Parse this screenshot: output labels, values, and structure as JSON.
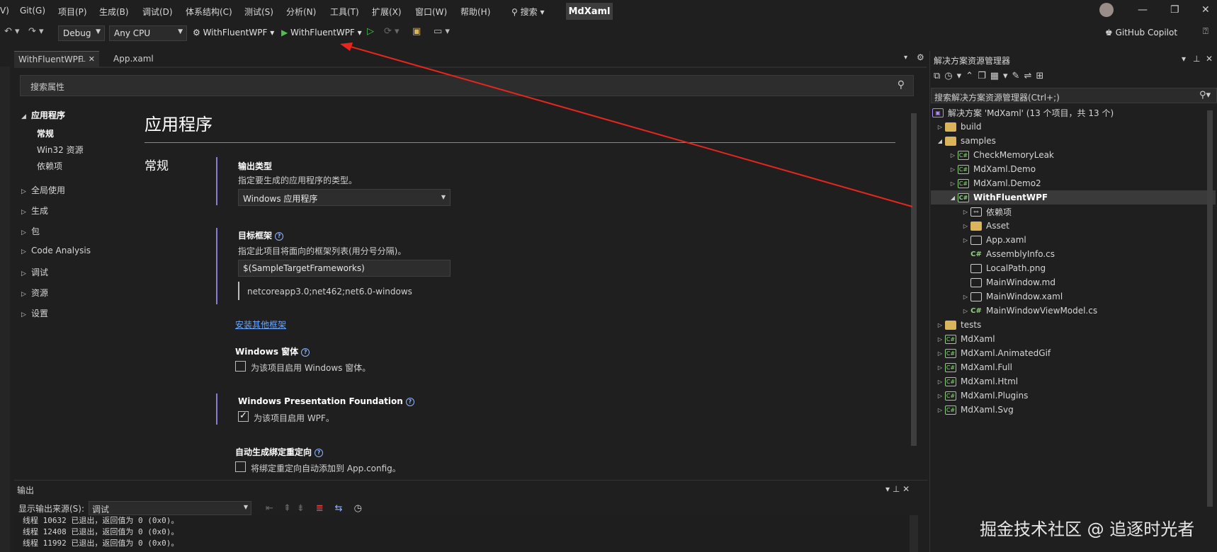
{
  "menu": {
    "items": [
      "Git(G)",
      "项目(P)",
      "生成(B)",
      "调试(D)",
      "体系结构(C)",
      "测试(S)",
      "分析(N)",
      "工具(T)",
      "扩展(X)",
      "窗口(W)",
      "帮助(H)"
    ],
    "search_label": "搜索",
    "window_title": "MdXaml"
  },
  "toolbar": {
    "config": "Debug",
    "platform": "Any CPU",
    "startup_project": "WithFluentWPF",
    "run_target": "WithFluentWPF",
    "copilot": "GitHub Copilot"
  },
  "tabs": [
    {
      "label": "WithFluentWPF",
      "active": true
    },
    {
      "label": "App.xaml",
      "active": false
    }
  ],
  "properties": {
    "search_placeholder": "搜索属性",
    "nav": [
      {
        "label": "应用程序",
        "expanded": true,
        "children": [
          "常规",
          "Win32 资源",
          "依赖项"
        ]
      },
      {
        "label": "全局使用"
      },
      {
        "label": "生成"
      },
      {
        "label": "包"
      },
      {
        "label": "Code Analysis"
      },
      {
        "label": "调试"
      },
      {
        "label": "资源"
      },
      {
        "label": "设置"
      }
    ],
    "heading": "应用程序",
    "section": "常规",
    "output_type": {
      "label": "输出类型",
      "desc": "指定要生成的应用程序的类型。",
      "value": "Windows 应用程序"
    },
    "target_framework": {
      "label": "目标框架",
      "desc": "指定此项目将面向的框架列表(用分号分隔)。",
      "value": "$(SampleTargetFrameworks)",
      "evaluated": "netcoreapp3.0;net462;net6.0-windows",
      "install_link": "安装其他框架"
    },
    "winforms": {
      "label": "Windows 窗体",
      "checkbox": "为该项目启用 Windows 窗体。",
      "checked": false
    },
    "wpf": {
      "label": "Windows Presentation Foundation",
      "checkbox": "为该项目启用 WPF。",
      "checked": true
    },
    "binding_redirect": {
      "label": "自动生成绑定重定向",
      "checkbox": "将绑定重定向自动添加到 App.config。",
      "checked": false
    }
  },
  "output": {
    "title": "输出",
    "source_label": "显示输出来源(S):",
    "source_value": "调试",
    "lines": [
      "线程 10632 已退出，返回值为 0 (0x0)。",
      "线程 12408 已退出，返回值为 0 (0x0)。",
      "线程 11992 已退出，返回值为 0 (0x0)。"
    ]
  },
  "solution_explorer": {
    "title": "解决方案资源管理器",
    "search_placeholder": "搜索解决方案资源管理器(Ctrl+;)",
    "solution": "解决方案 'MdXaml' (13 个项目，共 13 个)",
    "nodes": [
      {
        "label": "build",
        "type": "folder",
        "level": 0,
        "chev": "▷"
      },
      {
        "label": "samples",
        "type": "folder",
        "level": 0,
        "chev": "◢"
      },
      {
        "label": "CheckMemoryLeak",
        "type": "proj",
        "level": 1,
        "chev": "▷"
      },
      {
        "label": "MdXaml.Demo",
        "type": "proj",
        "level": 1,
        "chev": "▷"
      },
      {
        "label": "MdXaml.Demo2",
        "type": "proj",
        "level": 1,
        "chev": "▷"
      },
      {
        "label": "WithFluentWPF",
        "type": "proj",
        "level": 1,
        "chev": "◢",
        "selected": true
      },
      {
        "label": "依赖项",
        "type": "dep",
        "level": 2,
        "chev": "▷"
      },
      {
        "label": "Asset",
        "type": "folder",
        "level": 2,
        "chev": "▷"
      },
      {
        "label": "App.xaml",
        "type": "file",
        "level": 2,
        "chev": "▷"
      },
      {
        "label": "AssemblyInfo.cs",
        "type": "cs",
        "level": 2,
        "chev": ""
      },
      {
        "label": "LocalPath.png",
        "type": "file",
        "level": 2,
        "chev": ""
      },
      {
        "label": "MainWindow.md",
        "type": "file",
        "level": 2,
        "chev": ""
      },
      {
        "label": "MainWindow.xaml",
        "type": "file",
        "level": 2,
        "chev": "▷"
      },
      {
        "label": "MainWindowViewModel.cs",
        "type": "cs",
        "level": 2,
        "chev": "▷"
      },
      {
        "label": "tests",
        "type": "folder",
        "level": 0,
        "chev": "▷"
      },
      {
        "label": "MdXaml",
        "type": "proj",
        "level": 0,
        "chev": "▷"
      },
      {
        "label": "MdXaml.AnimatedGif",
        "type": "proj",
        "level": 0,
        "chev": "▷"
      },
      {
        "label": "MdXaml.Full",
        "type": "proj",
        "level": 0,
        "chev": "▷"
      },
      {
        "label": "MdXaml.Html",
        "type": "proj",
        "level": 0,
        "chev": "▷"
      },
      {
        "label": "MdXaml.Plugins",
        "type": "proj",
        "level": 0,
        "chev": "▷"
      },
      {
        "label": "MdXaml.Svg",
        "type": "proj",
        "level": 0,
        "chev": "▷"
      }
    ]
  },
  "watermark": "掘金技术社区 @ 追逐时光者",
  "colors": {
    "accent": "#8a7bd8",
    "annotation_arrow": "#e8261c",
    "link": "#6aa6ff"
  }
}
